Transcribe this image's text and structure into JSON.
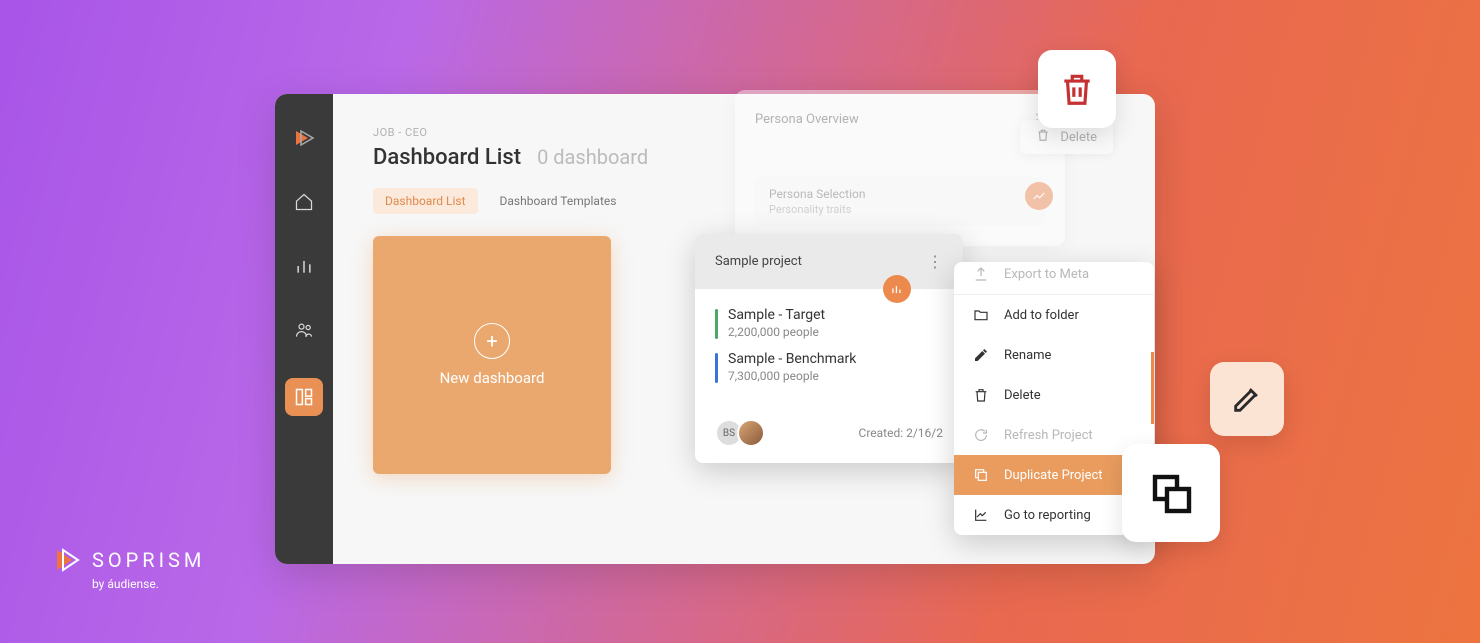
{
  "brand": {
    "name": "SOPRISM",
    "byline": "by áudiense."
  },
  "breadcrumb": "JOB - CEO",
  "page": {
    "title": "Dashboard List",
    "subtitle": "0 dashboard"
  },
  "tabs": {
    "list": "Dashboard List",
    "templates": "Dashboard Templates"
  },
  "newDashboard": {
    "label": "New dashboard"
  },
  "persona": {
    "title": "Persona Overview",
    "deleteLabel": "Delete",
    "selectionTitle": "Persona Selection",
    "traitLabel": "Personality traits"
  },
  "sample": {
    "title": "Sample project",
    "target": {
      "name": "Sample - Target",
      "people": "2,200,000 people"
    },
    "benchmark": {
      "name": "Sample - Benchmark",
      "people": "7,300,000 people"
    },
    "avatarInitials": "BS",
    "created": "Created: 2/16/2"
  },
  "menu": {
    "exportMeta": "Export to Meta",
    "addFolder": "Add to folder",
    "rename": "Rename",
    "delete": "Delete",
    "refresh": "Refresh Project",
    "duplicate": "Duplicate Project",
    "reporting": "Go to reporting"
  }
}
